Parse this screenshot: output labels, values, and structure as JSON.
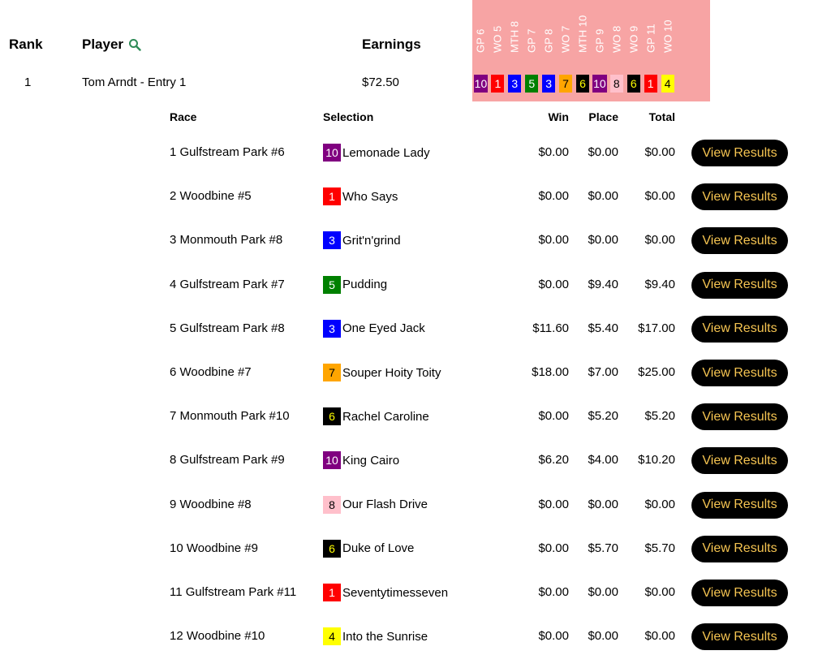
{
  "headers": {
    "rank": "Rank",
    "player": "Player",
    "earnings": "Earnings"
  },
  "entry": {
    "rank": "1",
    "player": "Tom Arndt - Entry 1",
    "earnings": "$72.50"
  },
  "race_labels": [
    "GP 6",
    "WO 5",
    "MTH 8",
    "GP 7",
    "GP 8",
    "WO 7",
    "MTH 10",
    "GP 9",
    "WO 8",
    "WO 9",
    "GP 11",
    "WO 10"
  ],
  "colors": {
    "strip_bg": "#f7a4a4",
    "button_bg": "#000000",
    "button_text": "#f5c451",
    "search_icon": "#2e8b57",
    "num_1": {
      "bg": "#ff0000",
      "fg": "#ffffff"
    },
    "num_3": {
      "bg": "#0000ff",
      "fg": "#ffffff"
    },
    "num_4": {
      "bg": "#ffff00",
      "fg": "#000000"
    },
    "num_5": {
      "bg": "#008000",
      "fg": "#ffffff"
    },
    "num_6": {
      "bg": "#000000",
      "fg": "#ffff00"
    },
    "num_7": {
      "bg": "#ffa500",
      "fg": "#000000"
    },
    "num_8": {
      "bg": "#ffc0cb",
      "fg": "#000000"
    },
    "num_10": {
      "bg": "#800080",
      "fg": "#ffffff"
    }
  },
  "sub_headers": {
    "race": "Race",
    "selection": "Selection",
    "win": "Win",
    "place": "Place",
    "total": "Total"
  },
  "button_label": "View Results",
  "races": [
    {
      "race": "1 Gulfstream Park #6",
      "num": "10",
      "horse": "Lemonade Lady",
      "win": "$0.00",
      "place": "$0.00",
      "total": "$0.00"
    },
    {
      "race": "2 Woodbine #5",
      "num": "1",
      "horse": "Who Says",
      "win": "$0.00",
      "place": "$0.00",
      "total": "$0.00"
    },
    {
      "race": "3 Monmouth Park #8",
      "num": "3",
      "horse": "Grit'n'grind",
      "win": "$0.00",
      "place": "$0.00",
      "total": "$0.00"
    },
    {
      "race": "4 Gulfstream Park #7",
      "num": "5",
      "horse": "Pudding",
      "win": "$0.00",
      "place": "$9.40",
      "total": "$9.40"
    },
    {
      "race": "5 Gulfstream Park #8",
      "num": "3",
      "horse": "One Eyed Jack",
      "win": "$11.60",
      "place": "$5.40",
      "total": "$17.00"
    },
    {
      "race": "6 Woodbine #7",
      "num": "7",
      "horse": "Souper Hoity Toity",
      "win": "$18.00",
      "place": "$7.00",
      "total": "$25.00"
    },
    {
      "race": "7 Monmouth Park #10",
      "num": "6",
      "horse": "Rachel Caroline",
      "win": "$0.00",
      "place": "$5.20",
      "total": "$5.20"
    },
    {
      "race": "8 Gulfstream Park #9",
      "num": "10",
      "horse": "King Cairo",
      "win": "$6.20",
      "place": "$4.00",
      "total": "$10.20"
    },
    {
      "race": "9 Woodbine #8",
      "num": "8",
      "horse": "Our Flash Drive",
      "win": "$0.00",
      "place": "$0.00",
      "total": "$0.00"
    },
    {
      "race": "10 Woodbine #9",
      "num": "6",
      "horse": "Duke of Love",
      "win": "$0.00",
      "place": "$5.70",
      "total": "$5.70"
    },
    {
      "race": "11 Gulfstream Park #11",
      "num": "1",
      "horse": "Seventytimesseven",
      "win": "$0.00",
      "place": "$0.00",
      "total": "$0.00"
    },
    {
      "race": "12 Woodbine #10",
      "num": "4",
      "horse": "Into the Sunrise",
      "win": "$0.00",
      "place": "$0.00",
      "total": "$0.00"
    }
  ]
}
